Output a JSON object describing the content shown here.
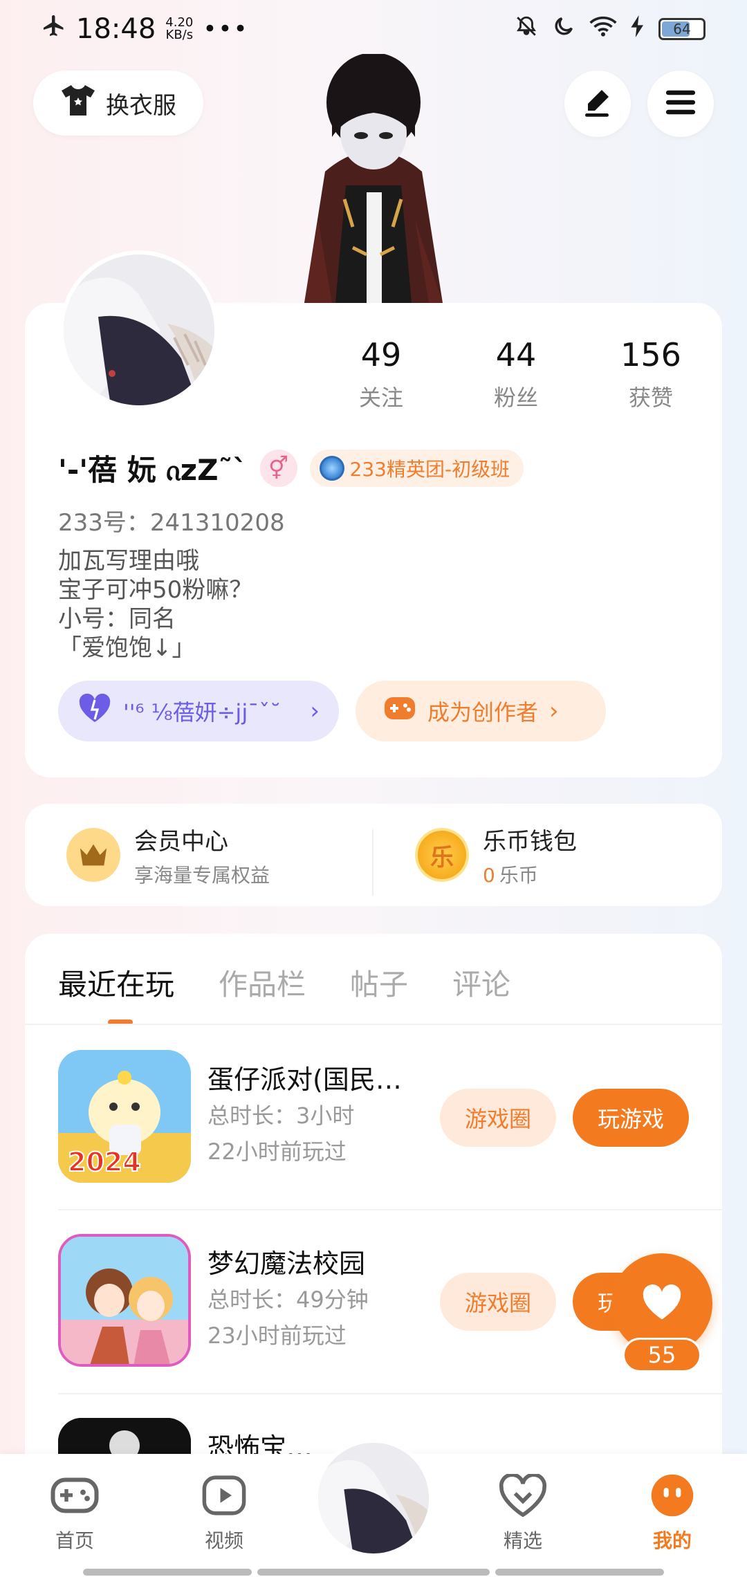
{
  "status_bar": {
    "time": "18:48",
    "net_speed": "4.20",
    "net_unit": "KB/s",
    "dots": "•••",
    "battery": "64"
  },
  "top": {
    "wardrobe_label": "换衣服"
  },
  "profile": {
    "stats": [
      {
        "num": "49",
        "label": "关注"
      },
      {
        "num": "44",
        "label": "粉丝"
      },
      {
        "num": "156",
        "label": "获赞"
      }
    ],
    "nickname": "'-'蓓 妧 ᦵzZ˜`",
    "gender_symbol": "⚥",
    "group_badge": "233精英团-初级班",
    "uid": "233号：241310208",
    "bio": [
      "加瓦写理由哦",
      "宝子可冲50粉嘛？",
      "小号：同名",
      "「爱饱饱↓」"
    ],
    "fan_pill": "''⁶ ⅛蓓妍÷jj¯ˇ˘",
    "creator_pill": "成为创作者"
  },
  "member": {
    "title": "会员中心",
    "sub": "享海量专属权益",
    "wallet_title": "乐币钱包",
    "wallet_amount": "0",
    "wallet_unit": "乐币",
    "coin_char": "乐"
  },
  "tabs": [
    "最近在玩",
    "作品栏",
    "帖子",
    "评论"
  ],
  "games": [
    {
      "name": "蛋仔派对(国民…",
      "duration": "总时长：3小时",
      "last": "22小时前玩过",
      "circle": "游戏圈",
      "play": "玩游戏",
      "icon_text": "2024"
    },
    {
      "name": "梦幻魔法校园",
      "duration": "总时长：49分钟",
      "last": "23小时前玩过",
      "circle": "游戏圈",
      "play": "玩游戏"
    },
    {
      "name": "恐怖宝……"
    }
  ],
  "like": {
    "count": "55"
  },
  "nav": [
    "首页",
    "视频",
    "精选",
    "我的"
  ],
  "colors": {
    "accent": "#f47a1f",
    "purple": "#6d5ce6"
  }
}
